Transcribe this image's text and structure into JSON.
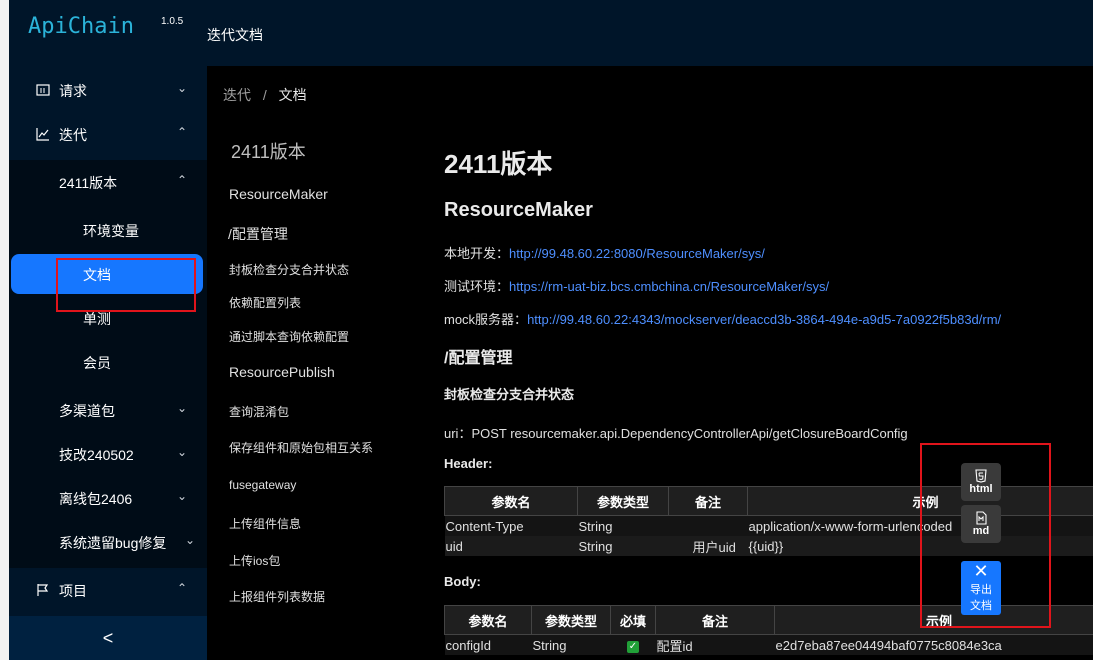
{
  "app": {
    "name": "ApiChain",
    "version": "1.0.5"
  },
  "header": {
    "title": "迭代文档"
  },
  "sidebar": {
    "items": [
      {
        "label": "请求",
        "icon": "layout-icon",
        "level": 0,
        "expanded": false
      },
      {
        "label": "迭代",
        "icon": "line-chart-icon",
        "level": 0,
        "expanded": true
      },
      {
        "label": "2411版本",
        "level": 1,
        "expanded": true
      },
      {
        "label": "环境变量",
        "level": 2
      },
      {
        "label": "文档",
        "level": 2,
        "active": true
      },
      {
        "label": "单测",
        "level": 2
      },
      {
        "label": "会员",
        "level": 2
      },
      {
        "label": "多渠道包",
        "level": 1,
        "expanded": false
      },
      {
        "label": "技改240502",
        "level": 1,
        "expanded": false
      },
      {
        "label": "离线包2406",
        "level": 1,
        "expanded": false
      },
      {
        "label": "系统遗留bug修复",
        "level": 1,
        "expanded": false
      },
      {
        "label": "项目",
        "icon": "flag-icon",
        "level": 0,
        "expanded": true
      }
    ],
    "collapse_label": "<"
  },
  "breadcrumb": {
    "parent": "迭代",
    "separator": "/",
    "current": "文档"
  },
  "toc": {
    "title": "2411版本",
    "items": [
      "ResourceMaker",
      "/配置管理",
      "封板检查分支合并状态",
      "依赖配置列表",
      "通过脚本查询依赖配置",
      "ResourcePublish",
      "查询混淆包",
      "保存组件和原始包相互关系",
      "fusegateway",
      "上传组件信息",
      "上传ios包",
      "上报组件列表数据"
    ]
  },
  "doc": {
    "title": "2411版本",
    "project": "ResourceMaker",
    "envs": [
      {
        "label": "本地开发：",
        "url": "http://99.48.60.22:8080/ResourceMaker/sys/"
      },
      {
        "label": "测试环境：",
        "url": "https://rm-uat-biz.bcs.cmbchina.cn/ResourceMaker/sys/"
      },
      {
        "label": "mock服务器：",
        "url": "http://99.48.60.22:4343/mockserver/deaccd3b-3864-494e-a9d5-7a0922f5b83d/rm/"
      }
    ],
    "folder": "/配置管理",
    "api_title": "封板检查分支合并状态",
    "uri": "uri：POST resourcemaker.api.DependencyControllerApi/getClosureBoardConfig",
    "header_label": "Header:",
    "header_table": {
      "columns": [
        "参数名",
        "参数类型",
        "备注",
        "示例"
      ],
      "rows": [
        [
          "Content-Type",
          "String",
          "",
          "application/x-www-form-urlencoded"
        ],
        [
          "uid",
          "String",
          "用户uid",
          "{{uid}}"
        ]
      ]
    },
    "body_label": "Body:",
    "body_table": {
      "columns": [
        "参数名",
        "参数类型",
        "必填",
        "备注",
        "示例"
      ],
      "rows": [
        [
          "configId",
          "String",
          "✓",
          "配置id",
          "e2d7eba87ee04494baf0775c8084e3ca"
        ]
      ]
    }
  },
  "export": {
    "html_label": "html",
    "md_label": "md",
    "main_label_1": "导出",
    "main_label_2": "文档"
  }
}
